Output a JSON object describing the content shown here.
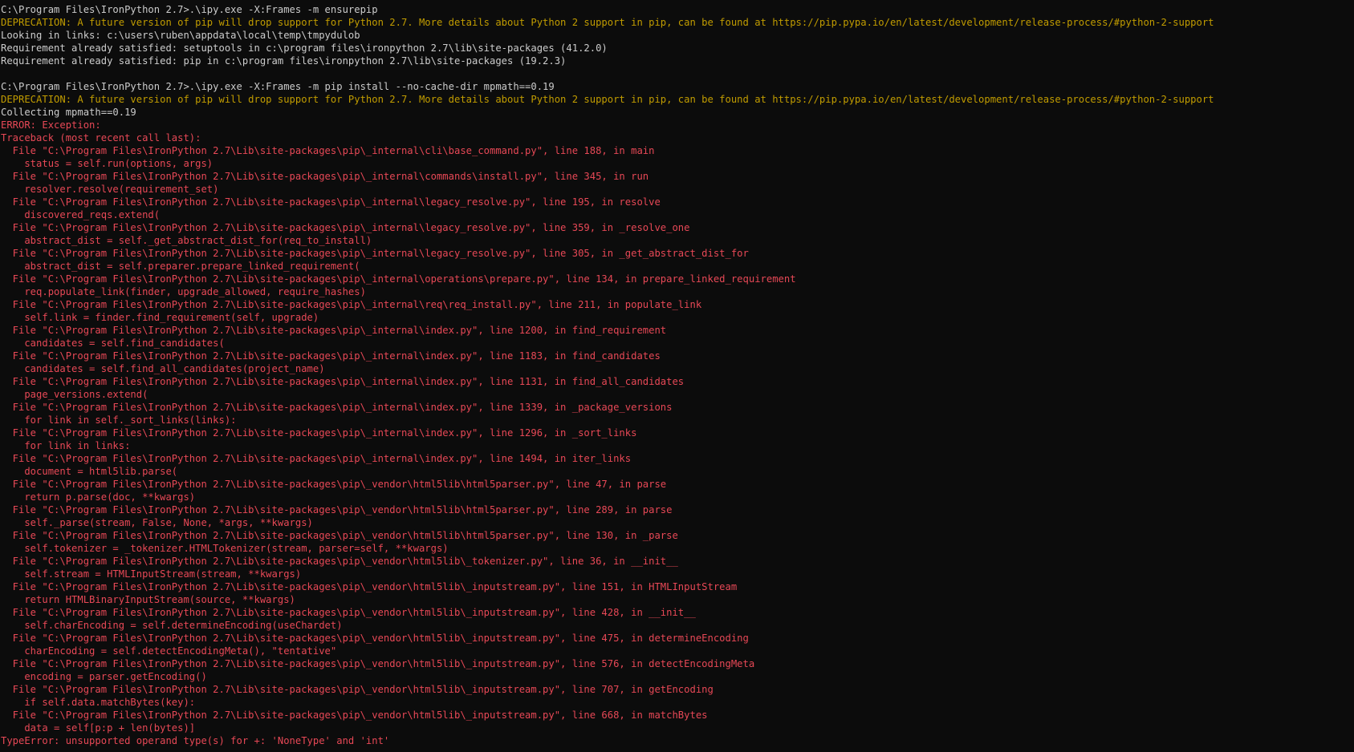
{
  "colors": {
    "background": "#0c0c0c",
    "normal": "#cccccc",
    "warning": "#c19c00",
    "error": "#e74856"
  },
  "lines": [
    {
      "kind": "normal",
      "text": "C:\\Program Files\\IronPython 2.7>.\\ipy.exe -X:Frames -m ensurepip"
    },
    {
      "kind": "warn",
      "text": "DEPRECATION: A future version of pip will drop support for Python 2.7. More details about Python 2 support in pip, can be found at https://pip.pypa.io/en/latest/development/release-process/#python-2-support"
    },
    {
      "kind": "normal",
      "text": "Looking in links: c:\\users\\ruben\\appdata\\local\\temp\\tmpydulob"
    },
    {
      "kind": "normal",
      "text": "Requirement already satisfied: setuptools in c:\\program files\\ironpython 2.7\\lib\\site-packages (41.2.0)"
    },
    {
      "kind": "normal",
      "text": "Requirement already satisfied: pip in c:\\program files\\ironpython 2.7\\lib\\site-packages (19.2.3)"
    },
    {
      "kind": "blank",
      "text": ""
    },
    {
      "kind": "normal",
      "text": "C:\\Program Files\\IronPython 2.7>.\\ipy.exe -X:Frames -m pip install --no-cache-dir mpmath==0.19"
    },
    {
      "kind": "warn",
      "text": "DEPRECATION: A future version of pip will drop support for Python 2.7. More details about Python 2 support in pip, can be found at https://pip.pypa.io/en/latest/development/release-process/#python-2-support"
    },
    {
      "kind": "normal",
      "text": "Collecting mpmath==0.19"
    },
    {
      "kind": "err",
      "text": "ERROR: Exception:"
    },
    {
      "kind": "err",
      "text": "Traceback (most recent call last):"
    },
    {
      "kind": "err",
      "text": "  File \"C:\\Program Files\\IronPython 2.7\\Lib\\site-packages\\pip\\_internal\\cli\\base_command.py\", line 188, in main"
    },
    {
      "kind": "err",
      "text": "    status = self.run(options, args)"
    },
    {
      "kind": "err",
      "text": "  File \"C:\\Program Files\\IronPython 2.7\\Lib\\site-packages\\pip\\_internal\\commands\\install.py\", line 345, in run"
    },
    {
      "kind": "err",
      "text": "    resolver.resolve(requirement_set)"
    },
    {
      "kind": "err",
      "text": "  File \"C:\\Program Files\\IronPython 2.7\\Lib\\site-packages\\pip\\_internal\\legacy_resolve.py\", line 195, in resolve"
    },
    {
      "kind": "err",
      "text": "    discovered_reqs.extend("
    },
    {
      "kind": "err",
      "text": "  File \"C:\\Program Files\\IronPython 2.7\\Lib\\site-packages\\pip\\_internal\\legacy_resolve.py\", line 359, in _resolve_one"
    },
    {
      "kind": "err",
      "text": "    abstract_dist = self._get_abstract_dist_for(req_to_install)"
    },
    {
      "kind": "err",
      "text": "  File \"C:\\Program Files\\IronPython 2.7\\Lib\\site-packages\\pip\\_internal\\legacy_resolve.py\", line 305, in _get_abstract_dist_for"
    },
    {
      "kind": "err",
      "text": "    abstract_dist = self.preparer.prepare_linked_requirement("
    },
    {
      "kind": "err",
      "text": "  File \"C:\\Program Files\\IronPython 2.7\\Lib\\site-packages\\pip\\_internal\\operations\\prepare.py\", line 134, in prepare_linked_requirement"
    },
    {
      "kind": "err",
      "text": "    req.populate_link(finder, upgrade_allowed, require_hashes)"
    },
    {
      "kind": "err",
      "text": "  File \"C:\\Program Files\\IronPython 2.7\\Lib\\site-packages\\pip\\_internal\\req\\req_install.py\", line 211, in populate_link"
    },
    {
      "kind": "err",
      "text": "    self.link = finder.find_requirement(self, upgrade)"
    },
    {
      "kind": "err",
      "text": "  File \"C:\\Program Files\\IronPython 2.7\\Lib\\site-packages\\pip\\_internal\\index.py\", line 1200, in find_requirement"
    },
    {
      "kind": "err",
      "text": "    candidates = self.find_candidates("
    },
    {
      "kind": "err",
      "text": "  File \"C:\\Program Files\\IronPython 2.7\\Lib\\site-packages\\pip\\_internal\\index.py\", line 1183, in find_candidates"
    },
    {
      "kind": "err",
      "text": "    candidates = self.find_all_candidates(project_name)"
    },
    {
      "kind": "err",
      "text": "  File \"C:\\Program Files\\IronPython 2.7\\Lib\\site-packages\\pip\\_internal\\index.py\", line 1131, in find_all_candidates"
    },
    {
      "kind": "err",
      "text": "    page_versions.extend("
    },
    {
      "kind": "err",
      "text": "  File \"C:\\Program Files\\IronPython 2.7\\Lib\\site-packages\\pip\\_internal\\index.py\", line 1339, in _package_versions"
    },
    {
      "kind": "err",
      "text": "    for link in self._sort_links(links):"
    },
    {
      "kind": "err",
      "text": "  File \"C:\\Program Files\\IronPython 2.7\\Lib\\site-packages\\pip\\_internal\\index.py\", line 1296, in _sort_links"
    },
    {
      "kind": "err",
      "text": "    for link in links:"
    },
    {
      "kind": "err",
      "text": "  File \"C:\\Program Files\\IronPython 2.7\\Lib\\site-packages\\pip\\_internal\\index.py\", line 1494, in iter_links"
    },
    {
      "kind": "err",
      "text": "    document = html5lib.parse("
    },
    {
      "kind": "err",
      "text": "  File \"C:\\Program Files\\IronPython 2.7\\Lib\\site-packages\\pip\\_vendor\\html5lib\\html5parser.py\", line 47, in parse"
    },
    {
      "kind": "err",
      "text": "    return p.parse(doc, **kwargs)"
    },
    {
      "kind": "err",
      "text": "  File \"C:\\Program Files\\IronPython 2.7\\Lib\\site-packages\\pip\\_vendor\\html5lib\\html5parser.py\", line 289, in parse"
    },
    {
      "kind": "err",
      "text": "    self._parse(stream, False, None, *args, **kwargs)"
    },
    {
      "kind": "err",
      "text": "  File \"C:\\Program Files\\IronPython 2.7\\Lib\\site-packages\\pip\\_vendor\\html5lib\\html5parser.py\", line 130, in _parse"
    },
    {
      "kind": "err",
      "text": "    self.tokenizer = _tokenizer.HTMLTokenizer(stream, parser=self, **kwargs)"
    },
    {
      "kind": "err",
      "text": "  File \"C:\\Program Files\\IronPython 2.7\\Lib\\site-packages\\pip\\_vendor\\html5lib\\_tokenizer.py\", line 36, in __init__"
    },
    {
      "kind": "err",
      "text": "    self.stream = HTMLInputStream(stream, **kwargs)"
    },
    {
      "kind": "err",
      "text": "  File \"C:\\Program Files\\IronPython 2.7\\Lib\\site-packages\\pip\\_vendor\\html5lib\\_inputstream.py\", line 151, in HTMLInputStream"
    },
    {
      "kind": "err",
      "text": "    return HTMLBinaryInputStream(source, **kwargs)"
    },
    {
      "kind": "err",
      "text": "  File \"C:\\Program Files\\IronPython 2.7\\Lib\\site-packages\\pip\\_vendor\\html5lib\\_inputstream.py\", line 428, in __init__"
    },
    {
      "kind": "err",
      "text": "    self.charEncoding = self.determineEncoding(useChardet)"
    },
    {
      "kind": "err",
      "text": "  File \"C:\\Program Files\\IronPython 2.7\\Lib\\site-packages\\pip\\_vendor\\html5lib\\_inputstream.py\", line 475, in determineEncoding"
    },
    {
      "kind": "err",
      "text": "    charEncoding = self.detectEncodingMeta(), \"tentative\""
    },
    {
      "kind": "err",
      "text": "  File \"C:\\Program Files\\IronPython 2.7\\Lib\\site-packages\\pip\\_vendor\\html5lib\\_inputstream.py\", line 576, in detectEncodingMeta"
    },
    {
      "kind": "err",
      "text": "    encoding = parser.getEncoding()"
    },
    {
      "kind": "err",
      "text": "  File \"C:\\Program Files\\IronPython 2.7\\Lib\\site-packages\\pip\\_vendor\\html5lib\\_inputstream.py\", line 707, in getEncoding"
    },
    {
      "kind": "err",
      "text": "    if self.data.matchBytes(key):"
    },
    {
      "kind": "err",
      "text": "  File \"C:\\Program Files\\IronPython 2.7\\Lib\\site-packages\\pip\\_vendor\\html5lib\\_inputstream.py\", line 668, in matchBytes"
    },
    {
      "kind": "err",
      "text": "    data = self[p:p + len(bytes)]"
    },
    {
      "kind": "err",
      "text": "TypeError: unsupported operand type(s) for +: 'NoneType' and 'int'"
    }
  ]
}
